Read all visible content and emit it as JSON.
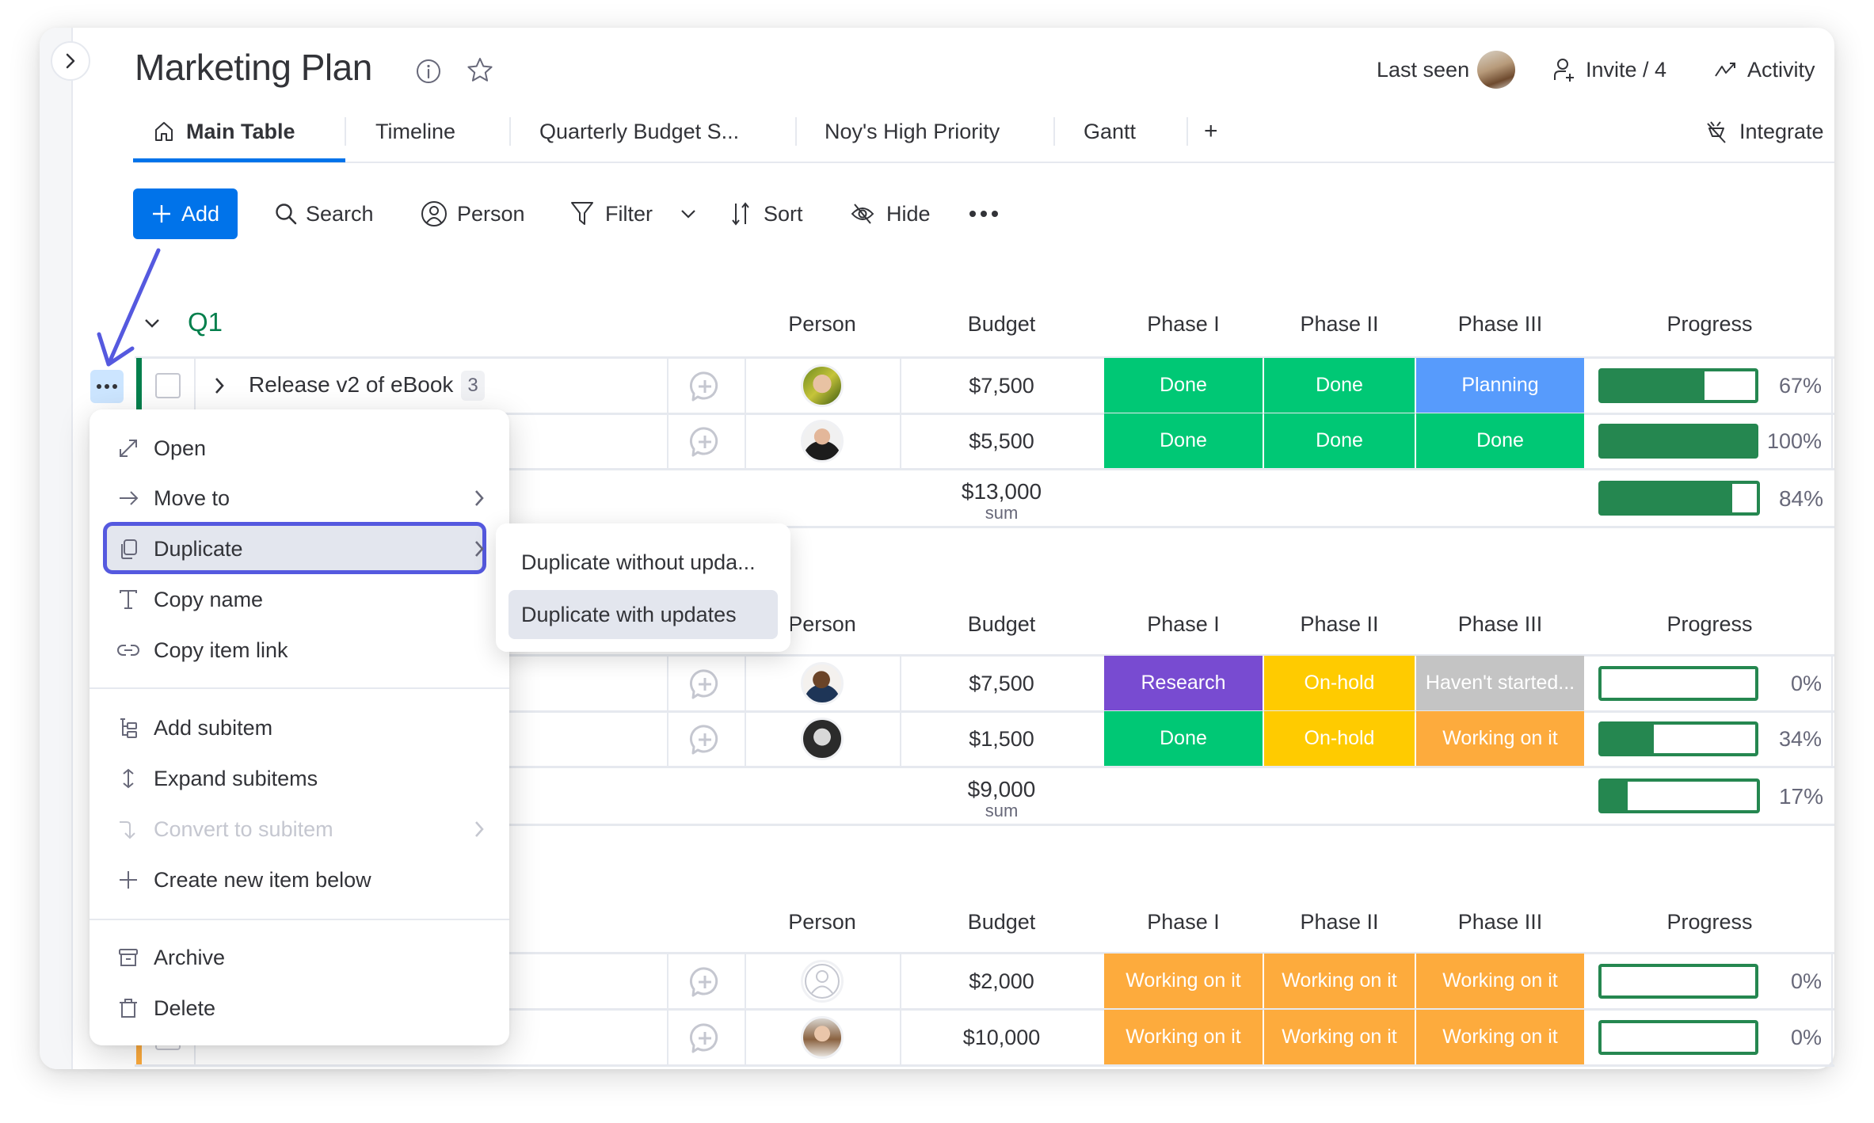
{
  "board": {
    "title": "Marketing Plan",
    "last_seen_label": "Last seen",
    "invite_label": "Invite / 4",
    "activity_label": "Activity",
    "integrate_label": "Integrate"
  },
  "tabs": [
    {
      "label": "Main Table",
      "active": true,
      "icon": "home-icon"
    },
    {
      "label": "Timeline"
    },
    {
      "label": "Quarterly Budget S..."
    },
    {
      "label": "Noy's High Priority"
    },
    {
      "label": "Gantt"
    },
    {
      "label": "+"
    }
  ],
  "toolbar": {
    "add_label": "Add",
    "search_label": "Search",
    "person_label": "Person",
    "filter_label": "Filter",
    "sort_label": "Sort",
    "hide_label": "Hide"
  },
  "columns": {
    "person": "Person",
    "budget": "Budget",
    "phase1": "Phase I",
    "phase2": "Phase II",
    "phase3": "Phase III",
    "progress": "Progress"
  },
  "status_colors": {
    "Done": "#00c875",
    "Planning": "#579bfc",
    "Research": "#784bd1",
    "On-hold": "#ffcb00",
    "Haven't started...": "#c4c4c4",
    "Working on it": "#fdab3d"
  },
  "groups": [
    {
      "name": "Q1",
      "color": "#037f4c",
      "rows": [
        {
          "name": "Release v2 of eBook",
          "subitems": "3",
          "person": "avatar-man-1",
          "budget": "$7,500",
          "phase1": "Done",
          "phase2": "Done",
          "phase3": "Planning",
          "progress": 67,
          "progress_label": "67%"
        },
        {
          "name": "",
          "person": "avatar-man-2",
          "budget": "$5,500",
          "phase1": "Done",
          "phase2": "Done",
          "phase3": "Done",
          "progress": 100,
          "progress_label": "100%"
        }
      ],
      "sum": {
        "budget": "$13,000",
        "budget_label": "sum",
        "progress": 84,
        "progress_label": "84%"
      }
    },
    {
      "name": "",
      "color": "",
      "rows": [
        {
          "name": "",
          "person": "avatar-man-3",
          "budget": "$7,500",
          "phase1": "Research",
          "phase2": "On-hold",
          "phase3": "Haven't started...",
          "progress": 0,
          "progress_label": "0%"
        },
        {
          "name": "",
          "person": "avatar-woman-1",
          "budget": "$1,500",
          "phase1": "Done",
          "phase2": "On-hold",
          "phase3": "Working on it",
          "progress": 34,
          "progress_label": "34%"
        }
      ],
      "sum": {
        "budget": "$9,000",
        "budget_label": "sum",
        "progress": 17,
        "progress_label": "17%"
      }
    },
    {
      "name": "",
      "color": "#fdab3d",
      "rows": [
        {
          "name": "",
          "person": "avatar-empty",
          "budget": "$2,000",
          "phase1": "Working on it",
          "phase2": "Working on it",
          "phase3": "Working on it",
          "progress": 0,
          "progress_label": "0%"
        },
        {
          "name": "",
          "person": "avatar-woman-2",
          "budget": "$10,000",
          "phase1": "Working on it",
          "phase2": "Working on it",
          "phase3": "Working on it",
          "progress": 0,
          "progress_label": "0%"
        }
      ]
    }
  ],
  "context_menu": {
    "items": [
      {
        "label": "Open",
        "icon": "open-expand-icon"
      },
      {
        "label": "Move to",
        "icon": "arrow-right-icon",
        "submenu": true
      },
      {
        "label": "Duplicate",
        "icon": "duplicate-icon",
        "submenu": true,
        "highlighted": true
      },
      {
        "label": "Copy name",
        "icon": "text-icon"
      },
      {
        "label": "Copy item link",
        "icon": "link-icon"
      },
      {
        "label": "Add subitem",
        "icon": "subitem-icon"
      },
      {
        "label": "Expand subitems",
        "icon": "expand-vertical-icon"
      },
      {
        "label": "Convert to subitem",
        "icon": "convert-icon",
        "submenu": true,
        "disabled": true
      },
      {
        "label": "Create new item below",
        "icon": "plus-icon"
      },
      {
        "label": "Archive",
        "icon": "archive-icon"
      },
      {
        "label": "Delete",
        "icon": "trash-icon"
      }
    ]
  },
  "duplicate_submenu": {
    "items": [
      {
        "label": "Duplicate without upda..."
      },
      {
        "label": "Duplicate with updates",
        "hovered": true
      }
    ]
  },
  "annotation": {
    "arrow_color": "#5559df"
  }
}
